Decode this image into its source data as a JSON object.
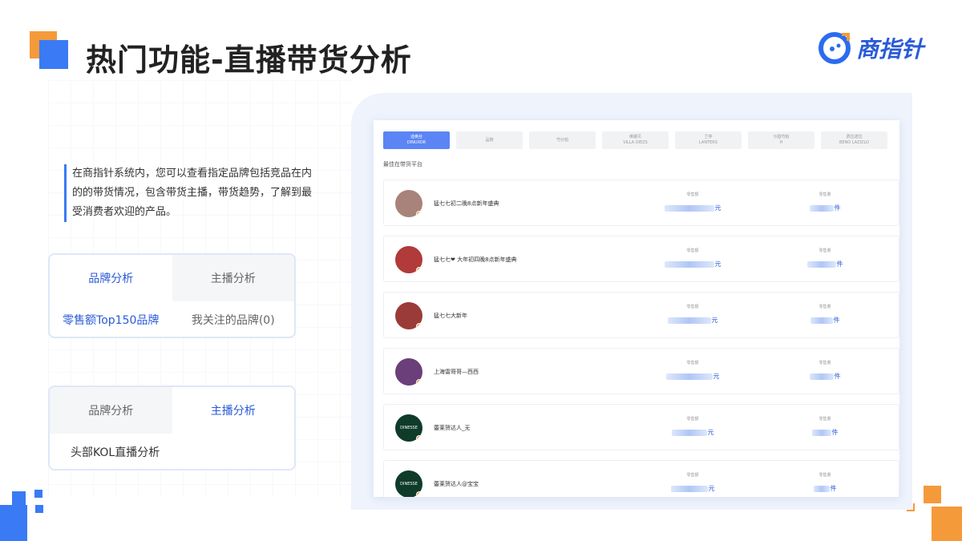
{
  "title": "热门功能-直播带货分析",
  "logo": {
    "text": "商指针"
  },
  "intro": {
    "text": "在商指针系统内，您可以查看指定品牌包括竞品在内的的带货情况，包含带货主播，带货趋势，了解到最受消费者欢迎的产品。"
  },
  "card1": {
    "tabs": [
      {
        "label": "品牌分析",
        "active": true
      },
      {
        "label": "主播分析",
        "active": false
      }
    ],
    "items": [
      {
        "label": "零售额Top150品牌"
      },
      {
        "label": "我关注的品牌(0)"
      }
    ]
  },
  "card2": {
    "tabs": [
      {
        "label": "品牌分析",
        "active": false
      },
      {
        "label": "主播分析",
        "active": true
      }
    ],
    "items": [
      {
        "label": "头部KOL直播分析"
      }
    ]
  },
  "panel": {
    "chips": [
      {
        "name": "迪奥丝",
        "sub": "DINUXOR",
        "active": true
      },
      {
        "name": "品牌",
        "sub": "",
        "active": false
      },
      {
        "name": "芍分柏",
        "sub": "",
        "active": false
      },
      {
        "name": "维娜贝",
        "sub": "VILLA DIEZS",
        "active": false
      },
      {
        "name": "兰亭",
        "sub": "LANTERS",
        "active": false
      },
      {
        "name": "沙圆芍柏",
        "sub": "H",
        "active": false
      },
      {
        "name": "费拉诺拉",
        "sub": "BENO LAZIZLO",
        "active": false
      }
    ],
    "section_label": "最佳在带货平台",
    "metric_label_1": "零售额",
    "metric_label_2": "零售量",
    "unit_1": "元",
    "unit_2": "件",
    "rows": [
      {
        "name": "猛七七初二晚8点新年盛典",
        "avatar": "#a7837a"
      },
      {
        "name": "猛七七❤ 大年初四晚8点新年盛典",
        "avatar": "#b13a3a"
      },
      {
        "name": "猛七七大新年",
        "avatar": "#9b3b38"
      },
      {
        "name": "上海雷哥哥—西西",
        "avatar": "#6b3f7a"
      },
      {
        "name": "蕾莱贺达人_无",
        "avatar": "#0f3b2a",
        "logo": "DINESSE"
      },
      {
        "name": "蕾莱贺达人@宝宝",
        "avatar": "#0f3b2a",
        "logo": "DINESSE"
      }
    ]
  }
}
